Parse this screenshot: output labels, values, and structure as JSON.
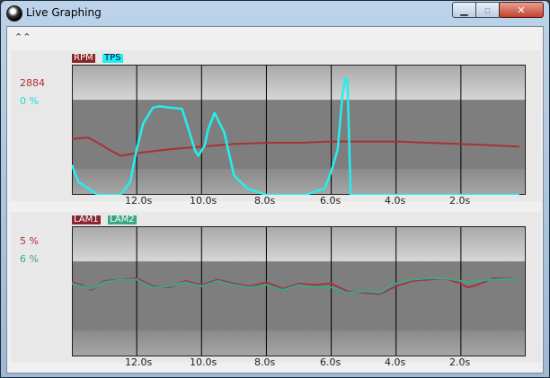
{
  "window": {
    "title": "Live Graphing",
    "minimize": "▁",
    "maximize": "▫",
    "close": "✕"
  },
  "toolbar": {
    "collapse_glyph": "⌃⌃"
  },
  "colors": {
    "rpm": "#a83232",
    "tps": "#22f0f0",
    "lam1": "#a83247",
    "lam2": "#3aa882"
  },
  "top_panel": {
    "legend": [
      "RPM",
      "TPS"
    ],
    "readouts": [
      {
        "text": "2884",
        "color": "#b03030"
      },
      {
        "text": "0 %",
        "color": "#22d8e0"
      }
    ]
  },
  "bottom_panel": {
    "legend": [
      "LAM1",
      "LAM2"
    ],
    "readouts": [
      {
        "text": "5 %",
        "color": "#b03030"
      },
      {
        "text": "6 %",
        "color": "#3aa882"
      }
    ]
  },
  "chart_data": [
    {
      "type": "line",
      "x_ticks": [
        "12.0s",
        "10.0s",
        "8.0s",
        "6.0s",
        "4.0s",
        "2.0s"
      ],
      "xlim": [
        14,
        0
      ],
      "ylim": [
        0,
        100
      ],
      "grid": true,
      "legend": "top-left",
      "series": [
        {
          "name": "RPM",
          "x": [
            14,
            13.5,
            13.2,
            12.8,
            12.5,
            12,
            11,
            10,
            9,
            8,
            7,
            6,
            5,
            4,
            3,
            2,
            1,
            0.2
          ],
          "y": [
            43,
            44,
            40,
            34,
            30,
            32,
            35,
            37,
            39,
            40,
            40,
            41,
            41,
            41,
            40,
            39,
            38,
            37
          ]
        },
        {
          "name": "TPS",
          "x": [
            14,
            13.8,
            13.2,
            12.5,
            12.2,
            12,
            11.8,
            11.6,
            11.5,
            11.3,
            11,
            10.6,
            10.4,
            10.2,
            10.1,
            9.9,
            9.8,
            9.6,
            9.3,
            9,
            8.6,
            8,
            7.3,
            6.8,
            6.2,
            6.0,
            5.8,
            5.65,
            5.55,
            5.5,
            5.4,
            5.2,
            4,
            3,
            2,
            1,
            0.2
          ],
          "y": [
            23,
            10,
            0,
            0,
            10,
            35,
            55,
            63,
            67,
            68,
            67,
            66,
            50,
            34,
            30,
            38,
            50,
            63,
            48,
            15,
            5,
            0,
            0,
            0,
            5,
            18,
            35,
            78,
            90,
            88,
            0,
            0,
            0,
            0,
            0,
            0,
            0
          ]
        }
      ]
    },
    {
      "type": "line",
      "x_ticks": [
        "12.0s",
        "10.0s",
        "8.0s",
        "6.0s",
        "4.0s",
        "2.0s"
      ],
      "xlim": [
        14,
        0
      ],
      "ylim": [
        0,
        100
      ],
      "grid": true,
      "legend": "top-left",
      "series": [
        {
          "name": "LAM1",
          "x": [
            14,
            13.7,
            13.4,
            13,
            12.5,
            12,
            11.5,
            11,
            10.5,
            10,
            9.5,
            9,
            8.5,
            8,
            7.5,
            7,
            6.5,
            6,
            5.5,
            5,
            4.5,
            4,
            3.5,
            3,
            2.5,
            2,
            1.8,
            1.5,
            1,
            0.2
          ],
          "y": [
            57,
            55,
            51,
            58,
            59,
            60,
            54,
            53,
            58,
            55,
            59,
            56,
            54,
            57,
            52,
            56,
            55,
            56,
            50,
            49,
            48,
            54,
            58,
            59,
            60,
            56,
            53,
            55,
            60,
            60
          ]
        },
        {
          "name": "LAM2",
          "x": [
            14,
            13.7,
            13.4,
            13,
            12.5,
            12,
            11.5,
            11,
            10.5,
            10,
            9.5,
            9,
            8.5,
            8,
            7.5,
            7,
            6.5,
            6,
            5.5,
            5,
            4.5,
            4,
            3.5,
            3,
            2.5,
            2,
            1.8,
            1.5,
            1,
            0.2
          ],
          "y": [
            56,
            54,
            52,
            57,
            59,
            59,
            53,
            54,
            57,
            54,
            58,
            55,
            53,
            55,
            51,
            55,
            53,
            53,
            49,
            50,
            49,
            56,
            59,
            60,
            60,
            58,
            57,
            58,
            59,
            60
          ]
        }
      ]
    }
  ]
}
